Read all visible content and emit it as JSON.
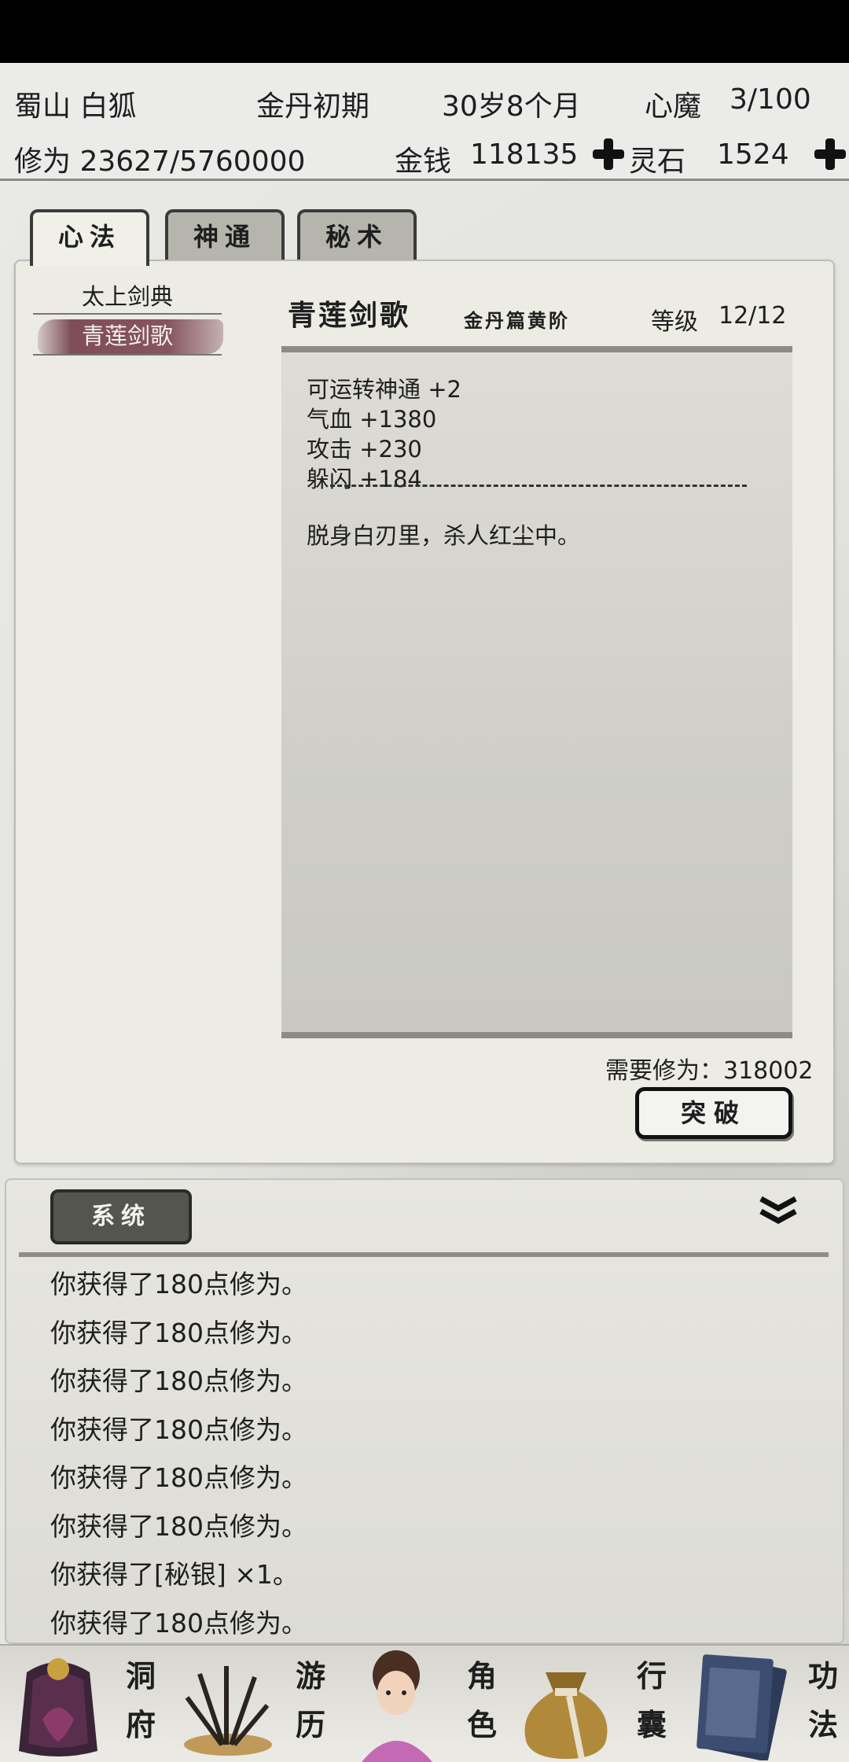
{
  "header": {
    "name": "蜀山 白狐",
    "realm": "金丹初期",
    "age": "30岁8个月",
    "demon_label": "心魔",
    "demon_value": "3/100",
    "cultivation": "修为 23627/5760000",
    "money_label": "金钱",
    "money_value": "118135",
    "stone_label": "灵石",
    "stone_value": "1524"
  },
  "tabs": [
    {
      "label": "心法",
      "active": true
    },
    {
      "label": "神通",
      "active": false
    },
    {
      "label": "秘术",
      "active": false
    }
  ],
  "skill_list": [
    "太上剑典",
    "青莲剑歌"
  ],
  "selected_skill_index": 1,
  "skill": {
    "name": "青莲剑歌",
    "subtitle": "金丹篇黄阶",
    "level_label": "等级",
    "level_value": "12/12",
    "effects": [
      "可运转神通 +2",
      "气血 +1380",
      "攻击 +230",
      "躲闪 +184"
    ],
    "divider": "-------------------------",
    "quote": "脱身白刃里，杀人红尘中。",
    "requirement": "需要修为：318002",
    "breakthrough_label": "突破"
  },
  "log": {
    "tab_label": "系统",
    "lines": [
      "你获得了180点修为。",
      "你获得了180点修为。",
      "你获得了180点修为。",
      "你获得了180点修为。",
      "你获得了180点修为。",
      "你获得了180点修为。",
      "你获得了[秘银] ×1。",
      "你获得了180点修为。"
    ]
  },
  "nav": [
    {
      "label": "洞府",
      "icon": "cave-dwelling-icon"
    },
    {
      "label": "游历",
      "icon": "travel-grass-icon"
    },
    {
      "label": "角色",
      "icon": "character-portrait-icon"
    },
    {
      "label": "行囊",
      "icon": "bag-icon"
    },
    {
      "label": "功法",
      "icon": "scroll-book-icon"
    }
  ],
  "colors": {
    "status_bar": "#000000",
    "selected_brush": "#86545e",
    "panel": "#ecebe4",
    "log_tab": "#555550"
  }
}
